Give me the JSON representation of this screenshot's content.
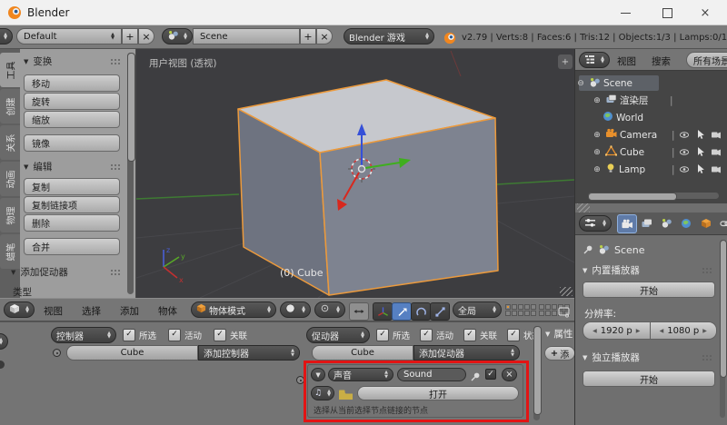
{
  "colors": {
    "accent_orange": "#f5a11a",
    "annotation_red": "#e21414",
    "active_blue": "#5680c2",
    "axis_x": "#d23b3b",
    "axis_y": "#58b22a",
    "axis_z": "#3b5bd7"
  },
  "icons": {
    "tri_down": "▼",
    "tri_up": "▲",
    "tri_left": "◀",
    "tri_right": "▶",
    "plus": "+",
    "close": "×",
    "check": "✓",
    "pipe": "|",
    "expand_plus": "⊕",
    "collapse_minus": "⊖",
    "note": "♫",
    "minimize": "—"
  },
  "title_bar": {
    "app_title": "Blender"
  },
  "info_bar": {
    "layout_name": "Default",
    "scene_name": "Scene",
    "engine": "Blender 游戏",
    "stats": "v2.79 | Verts:8 | Faces:6 | Tris:12 | Objects:1/3 | Lamps:0/1"
  },
  "tool_shelf": {
    "tabs": [
      {
        "label": "工具"
      },
      {
        "label": "创建"
      },
      {
        "label": "关系"
      },
      {
        "label": "动画"
      },
      {
        "label": "物理"
      },
      {
        "label": "蜡笔"
      }
    ],
    "panels": {
      "transform": {
        "title": "变换",
        "buttons": [
          {
            "label": "移动"
          },
          {
            "label": "旋转"
          },
          {
            "label": "缩放"
          },
          {
            "label": "镜像"
          }
        ]
      },
      "edit": {
        "title": "编辑",
        "buttons": [
          {
            "label": "复制"
          },
          {
            "label": "复制链接项"
          },
          {
            "label": "删除"
          },
          {
            "label": "合并"
          }
        ]
      },
      "add_actuator": {
        "title": "添加促动器",
        "type_label": "类型"
      }
    }
  },
  "viewport": {
    "view_label": "用户视图 (透视)",
    "object_label": "(0) Cube",
    "axis": {
      "x": "x",
      "y": "y",
      "z": "z"
    },
    "header": {
      "menus": [
        {
          "label": "视图"
        },
        {
          "label": "选择"
        },
        {
          "label": "添加"
        },
        {
          "label": "物体"
        }
      ],
      "mode": "物体模式",
      "orientation": "全局"
    }
  },
  "outliner": {
    "menus": [
      {
        "label": "视图"
      },
      {
        "label": "搜索"
      }
    ],
    "scope": "所有场景",
    "items": [
      {
        "label": "Scene",
        "icon": "scene-icon"
      },
      {
        "label": "渲染层",
        "icon": "render-layers-icon"
      },
      {
        "label": "World",
        "icon": "world-icon"
      },
      {
        "label": "Camera",
        "icon": "camera-icon"
      },
      {
        "label": "Cube",
        "icon": "mesh-data-icon"
      },
      {
        "label": "Lamp",
        "icon": "lamp-icon"
      }
    ]
  },
  "properties": {
    "breadcrumb": "Scene",
    "embedded_player": {
      "title": "内置播放器",
      "start_label": "开始"
    },
    "resolution_label": "分辨率:",
    "resolution_x": "1920 p",
    "resolution_y": "1080 p",
    "standalone_player": {
      "title": "独立播放器",
      "start_label": "开始"
    }
  },
  "logic_editor": {
    "controllers": {
      "title": "控制器",
      "filters": [
        {
          "label": "所选"
        },
        {
          "label": "活动"
        },
        {
          "label": "关联"
        }
      ],
      "object_name": "Cube",
      "add_label": "添加控制器"
    },
    "actuators": {
      "title": "促动器",
      "filters": [
        {
          "label": "所选"
        },
        {
          "label": "活动"
        },
        {
          "label": "关联"
        },
        {
          "label": "状态"
        }
      ],
      "object_name": "Cube",
      "add_label": "添加促动器"
    },
    "sound_actuator": {
      "type": "声音",
      "name": "Sound",
      "open_label": "打开",
      "hint": "选择从当前选择节点链接的节点"
    },
    "properties_region": {
      "title": "属性",
      "add_label": "添"
    }
  }
}
